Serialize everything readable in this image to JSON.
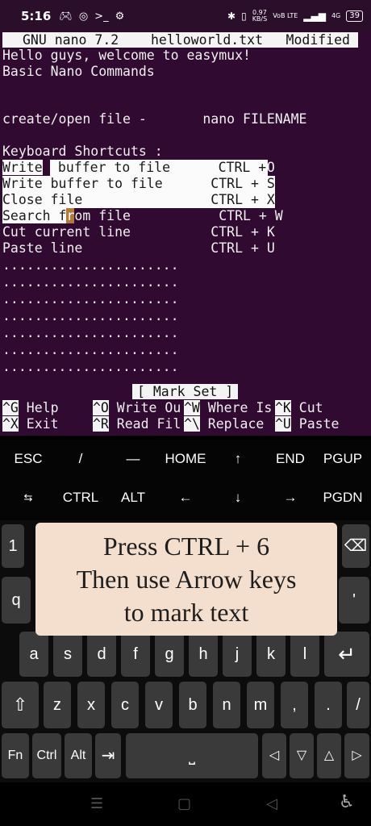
{
  "status_bar": {
    "time": "5:16",
    "left_icons": [
      "gamepad-icon",
      "instagram-icon",
      "terminal-icon",
      "notification-icon"
    ],
    "net_speed_value": "0.97",
    "net_speed_unit": "KB/S",
    "volte": "VoB LTE",
    "signal": "4G",
    "battery": "39"
  },
  "nano": {
    "title_app": "GNU nano 7.2",
    "title_file": "helloworld.txt",
    "title_status": "Modified",
    "lines": [
      "Hello guys, welcome to easymux!",
      "Basic Nano Commands",
      "create/open file -       nano FILENAME",
      "Keyboard Shortcuts :"
    ],
    "selected": {
      "r1_a": "Write",
      "r1_b": " buffer to file      CTRL + O",
      "r2": "Write buffer to file      CTRL + S",
      "r3": "Close file                CTRL + X",
      "r4_a": "Search f",
      "r4_cursor": "r",
      "r4_b": "om file           CTRL + W"
    },
    "more_lines": [
      "Cut current line          CTRL + K",
      "Paste line                CTRL + U"
    ],
    "dots": "......................",
    "status_message": "[ Mark Set ]",
    "help": {
      "row1": [
        {
          "key": "^G",
          "label": " Help     "
        },
        {
          "key": "^O",
          "label": " Write Ou"
        },
        {
          "key": "^W",
          "label": " Where Is"
        },
        {
          "key": "^K",
          "label": " Cut"
        }
      ],
      "row2": [
        {
          "key": "^X",
          "label": " Exit     "
        },
        {
          "key": "^R",
          "label": " Read Fil"
        },
        {
          "key": "^\\",
          "label": " Replace "
        },
        {
          "key": "^U",
          "label": " Paste"
        }
      ]
    }
  },
  "extra_keys": {
    "row1": [
      "ESC",
      "/",
      "—",
      "HOME",
      "↑",
      "END",
      "PGUP"
    ],
    "row2": [
      "⇆",
      "CTRL",
      "ALT",
      "←",
      "↓",
      "→",
      "PGDN"
    ]
  },
  "keyboard": {
    "row_numbers_first": "1",
    "row1_first": "q",
    "row1_last": "'",
    "row2": [
      "a",
      "s",
      "d",
      "f",
      "g",
      "h",
      "j",
      "k",
      "l"
    ],
    "row3": [
      "z",
      "x",
      "c",
      "v",
      "b",
      "n",
      "m",
      ",",
      ".",
      "/"
    ],
    "row4": [
      "Fn",
      "Ctrl",
      "Alt"
    ],
    "arrows": [
      "◁",
      "▽",
      "△",
      "▷"
    ]
  },
  "overlay": {
    "line1": "Press CTRL + 6",
    "line2": "Then use Arrow keys",
    "line3": "to mark text"
  }
}
